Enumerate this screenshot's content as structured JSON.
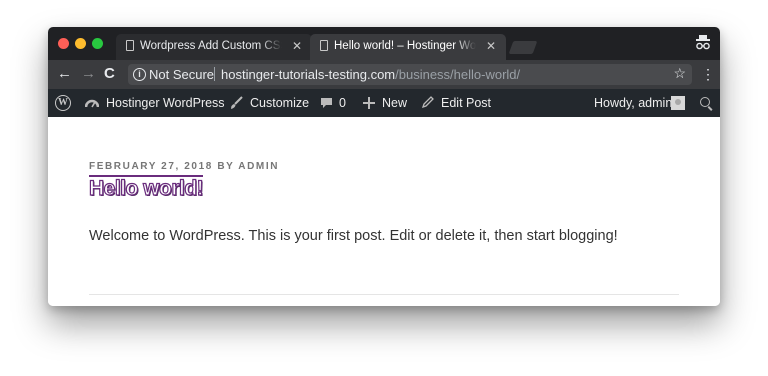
{
  "browser": {
    "tabs": [
      {
        "title": "Wordpress Add Custom CSS ‹",
        "active": false
      },
      {
        "title": "Hello world! – Hostinger WordPress",
        "active": true
      }
    ],
    "close_glyph": "✕",
    "toolbar": {
      "back_icon": "←",
      "forward_icon": "→",
      "reload_icon": "C",
      "security_label": "Not Secure",
      "url_host": "hostinger-tutorials-testing.com",
      "url_path": "/business/hello-world/",
      "bookmark_icon": "☆",
      "menu_icon": "⋮"
    },
    "traffic_lights": {
      "close": "#ff5f57",
      "minimize": "#febc2e",
      "maximize": "#28c840"
    }
  },
  "admin_bar": {
    "site_name": "Hostinger WordPress",
    "customize": "Customize",
    "comments_count": "0",
    "new": "New",
    "edit_post": "Edit Post",
    "greeting": "Howdy, admin",
    "icons": {
      "wp_logo": "wordpress-logo-icon",
      "dashboard": "dashboard-icon",
      "customize": "brush-icon",
      "comments": "comment-bubble-icon",
      "new": "plus-icon",
      "edit": "pencil-icon",
      "search": "search-icon"
    },
    "background": "#23282d"
  },
  "post": {
    "date": "FEBRUARY 27, 2018",
    "by": "BY",
    "author": "ADMIN",
    "title": "Hello world!",
    "body": "Welcome to WordPress. This is your first post. Edit or delete it, then start blogging!",
    "title_accent": "#6a2c7d"
  }
}
